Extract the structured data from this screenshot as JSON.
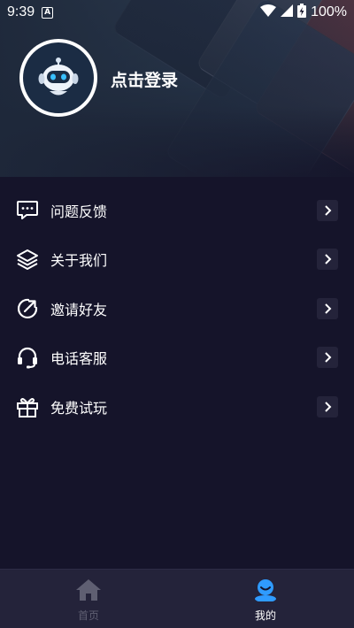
{
  "status_bar": {
    "time": "9:39",
    "notification_badge": "A",
    "battery": "100%",
    "icons": [
      "wifi-icon",
      "signal-icon",
      "battery-charging-icon"
    ]
  },
  "profile": {
    "login_label": "点击登录",
    "avatar_icon": "robot-avatar-icon"
  },
  "menu": {
    "items": [
      {
        "label": "问题反馈",
        "icon": "feedback-icon"
      },
      {
        "label": "关于我们",
        "icon": "layers-icon"
      },
      {
        "label": "邀请好友",
        "icon": "share-icon"
      },
      {
        "label": "电话客服",
        "icon": "headset-icon"
      },
      {
        "label": "免费试玩",
        "icon": "gift-icon"
      }
    ]
  },
  "bottom_nav": {
    "items": [
      {
        "label": "首页",
        "icon": "home-icon",
        "active": false
      },
      {
        "label": "我的",
        "icon": "user-icon",
        "active": true
      }
    ]
  },
  "colors": {
    "background": "#15142a",
    "nav_background": "#24233a",
    "arrow_bg": "#24233a",
    "active_accent": "#2f9bff",
    "inactive_text": "#5f5f72"
  }
}
